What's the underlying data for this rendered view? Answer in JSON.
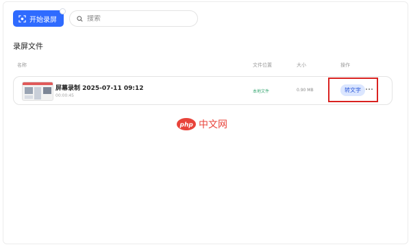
{
  "toolbar": {
    "record_label": "开始录屏",
    "search_placeholder": "搜索"
  },
  "main": {
    "section_title": "录屏文件",
    "columns": {
      "name": "名称",
      "location": "文件位置",
      "size": "大小",
      "actions": "操作"
    },
    "rows": [
      {
        "name": "屏幕录制 2025-07-11 09:12",
        "duration": "00:00:45",
        "location": "本地文件",
        "size": "0.90 MB",
        "to_text_label": "转文字"
      }
    ]
  },
  "watermark": {
    "logo": "php中文网"
  },
  "colors": {
    "primary": "#2f6bff",
    "location_text": "#3aa874",
    "highlight": "#d9211f"
  }
}
